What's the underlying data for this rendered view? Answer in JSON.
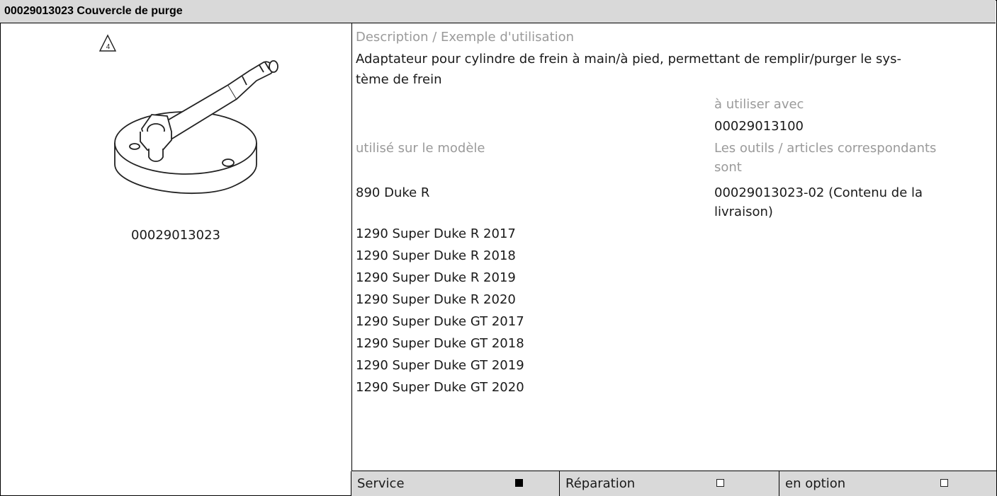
{
  "header": {
    "title": "00029013023 Couvercle de purge"
  },
  "figure": {
    "warning_number": "4",
    "part_number": "00029013023"
  },
  "description": {
    "label": "Description / Exemple d'utilisation",
    "line1": "Adaptateur pour cylindre de frein à main/à pied, permettant de remplir/purger le sys-",
    "line2": "tème de frein"
  },
  "use_with": {
    "label": "à utiliser avec",
    "value": "00029013100"
  },
  "models": {
    "label": "utilisé sur le modèle",
    "items": [
      "890 Duke R",
      "1290 Super Duke R 2017",
      "1290 Super Duke R 2018",
      "1290 Super Duke R 2019",
      "1290 Super Duke R 2020",
      "1290 Super Duke GT 2017",
      "1290 Super Duke GT 2018",
      "1290 Super Duke GT 2019",
      "1290 Super Duke GT 2020"
    ]
  },
  "related": {
    "label_line1": "Les outils / articles correspondants",
    "label_line2": "sont",
    "value_line1": "00029013023-02 (Contenu de la",
    "value_line2": "livraison)"
  },
  "footer": {
    "service": {
      "label": "Service",
      "checked": true
    },
    "repair": {
      "label": "Réparation",
      "checked": false
    },
    "optional": {
      "label": "en option",
      "checked": false
    }
  }
}
